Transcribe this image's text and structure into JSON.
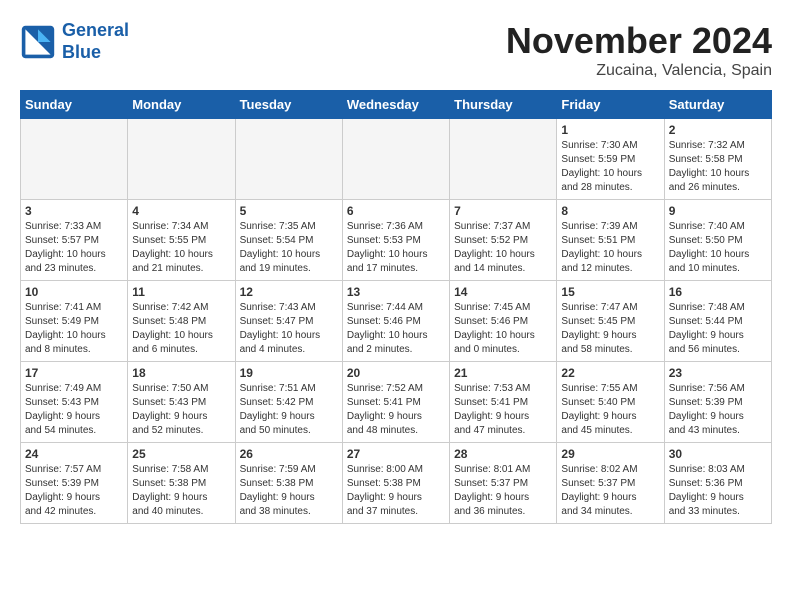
{
  "header": {
    "logo_line1": "General",
    "logo_line2": "Blue",
    "month": "November 2024",
    "location": "Zucaina, Valencia, Spain"
  },
  "weekdays": [
    "Sunday",
    "Monday",
    "Tuesday",
    "Wednesday",
    "Thursday",
    "Friday",
    "Saturday"
  ],
  "weeks": [
    [
      {
        "day": "",
        "info": "",
        "empty": true
      },
      {
        "day": "",
        "info": "",
        "empty": true
      },
      {
        "day": "",
        "info": "",
        "empty": true
      },
      {
        "day": "",
        "info": "",
        "empty": true
      },
      {
        "day": "",
        "info": "",
        "empty": true
      },
      {
        "day": "1",
        "info": "Sunrise: 7:30 AM\nSunset: 5:59 PM\nDaylight: 10 hours\nand 28 minutes."
      },
      {
        "day": "2",
        "info": "Sunrise: 7:32 AM\nSunset: 5:58 PM\nDaylight: 10 hours\nand 26 minutes."
      }
    ],
    [
      {
        "day": "3",
        "info": "Sunrise: 7:33 AM\nSunset: 5:57 PM\nDaylight: 10 hours\nand 23 minutes."
      },
      {
        "day": "4",
        "info": "Sunrise: 7:34 AM\nSunset: 5:55 PM\nDaylight: 10 hours\nand 21 minutes."
      },
      {
        "day": "5",
        "info": "Sunrise: 7:35 AM\nSunset: 5:54 PM\nDaylight: 10 hours\nand 19 minutes."
      },
      {
        "day": "6",
        "info": "Sunrise: 7:36 AM\nSunset: 5:53 PM\nDaylight: 10 hours\nand 17 minutes."
      },
      {
        "day": "7",
        "info": "Sunrise: 7:37 AM\nSunset: 5:52 PM\nDaylight: 10 hours\nand 14 minutes."
      },
      {
        "day": "8",
        "info": "Sunrise: 7:39 AM\nSunset: 5:51 PM\nDaylight: 10 hours\nand 12 minutes."
      },
      {
        "day": "9",
        "info": "Sunrise: 7:40 AM\nSunset: 5:50 PM\nDaylight: 10 hours\nand 10 minutes."
      }
    ],
    [
      {
        "day": "10",
        "info": "Sunrise: 7:41 AM\nSunset: 5:49 PM\nDaylight: 10 hours\nand 8 minutes."
      },
      {
        "day": "11",
        "info": "Sunrise: 7:42 AM\nSunset: 5:48 PM\nDaylight: 10 hours\nand 6 minutes."
      },
      {
        "day": "12",
        "info": "Sunrise: 7:43 AM\nSunset: 5:47 PM\nDaylight: 10 hours\nand 4 minutes."
      },
      {
        "day": "13",
        "info": "Sunrise: 7:44 AM\nSunset: 5:46 PM\nDaylight: 10 hours\nand 2 minutes."
      },
      {
        "day": "14",
        "info": "Sunrise: 7:45 AM\nSunset: 5:46 PM\nDaylight: 10 hours\nand 0 minutes."
      },
      {
        "day": "15",
        "info": "Sunrise: 7:47 AM\nSunset: 5:45 PM\nDaylight: 9 hours\nand 58 minutes."
      },
      {
        "day": "16",
        "info": "Sunrise: 7:48 AM\nSunset: 5:44 PM\nDaylight: 9 hours\nand 56 minutes."
      }
    ],
    [
      {
        "day": "17",
        "info": "Sunrise: 7:49 AM\nSunset: 5:43 PM\nDaylight: 9 hours\nand 54 minutes."
      },
      {
        "day": "18",
        "info": "Sunrise: 7:50 AM\nSunset: 5:43 PM\nDaylight: 9 hours\nand 52 minutes."
      },
      {
        "day": "19",
        "info": "Sunrise: 7:51 AM\nSunset: 5:42 PM\nDaylight: 9 hours\nand 50 minutes."
      },
      {
        "day": "20",
        "info": "Sunrise: 7:52 AM\nSunset: 5:41 PM\nDaylight: 9 hours\nand 48 minutes."
      },
      {
        "day": "21",
        "info": "Sunrise: 7:53 AM\nSunset: 5:41 PM\nDaylight: 9 hours\nand 47 minutes."
      },
      {
        "day": "22",
        "info": "Sunrise: 7:55 AM\nSunset: 5:40 PM\nDaylight: 9 hours\nand 45 minutes."
      },
      {
        "day": "23",
        "info": "Sunrise: 7:56 AM\nSunset: 5:39 PM\nDaylight: 9 hours\nand 43 minutes."
      }
    ],
    [
      {
        "day": "24",
        "info": "Sunrise: 7:57 AM\nSunset: 5:39 PM\nDaylight: 9 hours\nand 42 minutes."
      },
      {
        "day": "25",
        "info": "Sunrise: 7:58 AM\nSunset: 5:38 PM\nDaylight: 9 hours\nand 40 minutes."
      },
      {
        "day": "26",
        "info": "Sunrise: 7:59 AM\nSunset: 5:38 PM\nDaylight: 9 hours\nand 38 minutes."
      },
      {
        "day": "27",
        "info": "Sunrise: 8:00 AM\nSunset: 5:38 PM\nDaylight: 9 hours\nand 37 minutes."
      },
      {
        "day": "28",
        "info": "Sunrise: 8:01 AM\nSunset: 5:37 PM\nDaylight: 9 hours\nand 36 minutes."
      },
      {
        "day": "29",
        "info": "Sunrise: 8:02 AM\nSunset: 5:37 PM\nDaylight: 9 hours\nand 34 minutes."
      },
      {
        "day": "30",
        "info": "Sunrise: 8:03 AM\nSunset: 5:36 PM\nDaylight: 9 hours\nand 33 minutes."
      }
    ]
  ]
}
